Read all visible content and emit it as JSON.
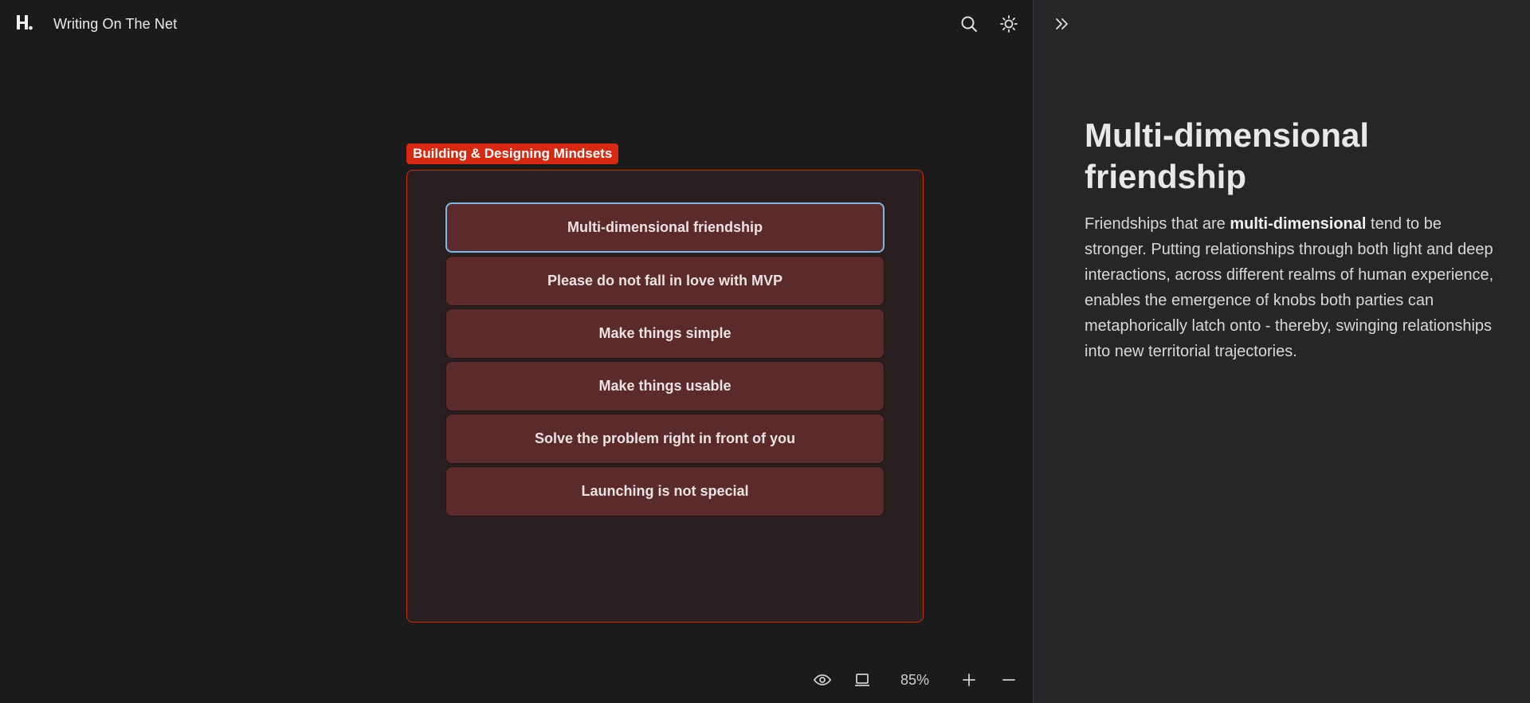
{
  "app": {
    "title": "Writing On The Net",
    "logo": "h-logo-icon"
  },
  "toolbar": {
    "search_icon": "search-icon",
    "theme_icon": "sun-icon"
  },
  "canvas": {
    "group_label": "Building & Designing Mindsets",
    "accent_color": "#d6290f",
    "cards": [
      {
        "label": "Multi-dimensional friendship",
        "selected": true
      },
      {
        "label": "Please do not fall in love with MVP",
        "selected": false
      },
      {
        "label": "Make things simple",
        "selected": false
      },
      {
        "label": "Make things usable",
        "selected": false
      },
      {
        "label": "Solve the problem right in front of you",
        "selected": false
      },
      {
        "label": "Launching is not special",
        "selected": false
      }
    ]
  },
  "bottom_bar": {
    "zoom": "85%",
    "icons": [
      "eye-icon",
      "laptop-icon",
      "plus-icon",
      "minus-icon"
    ]
  },
  "panel": {
    "collapse_icon": "double-chevron-right-icon",
    "title": "Multi-dimensional friendship",
    "body_pre": "Friendships that are ",
    "body_bold": "multi-dimensional",
    "body_post": " tend to be stronger. Putting relationships through both light and deep interactions, across different realms of human experience, enables the emergence of knobs both parties can metaphorically latch onto - thereby, swinging relationships into new territorial trajectories."
  }
}
